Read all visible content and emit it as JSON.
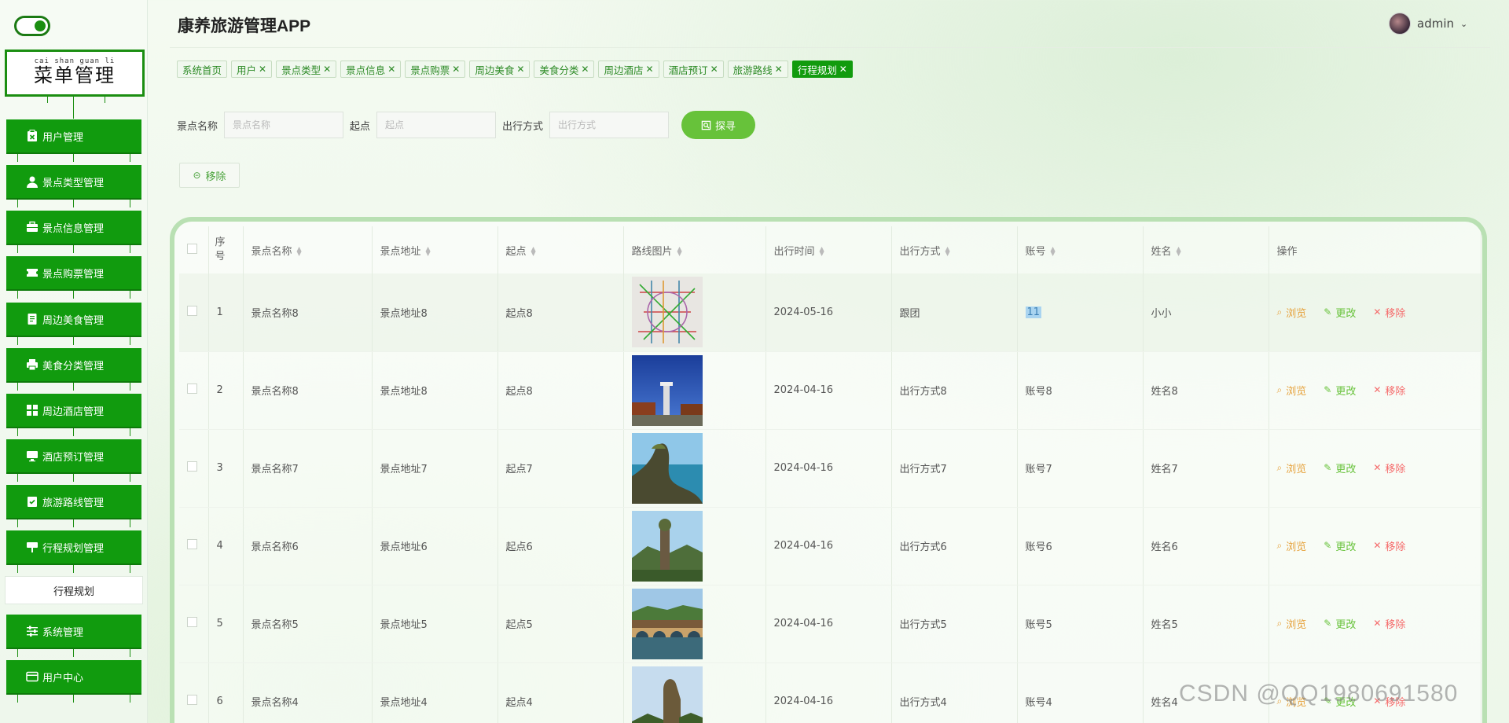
{
  "app": {
    "title": "康养旅游管理APP",
    "user": "admin"
  },
  "sidebar": {
    "title_pinyin": "cai  shan guan  li",
    "title": "菜单管理",
    "items": [
      {
        "label": "用户管理",
        "icon": "clipboard-x-icon"
      },
      {
        "label": "景点类型管理",
        "icon": "user-icon"
      },
      {
        "label": "景点信息管理",
        "icon": "briefcase-icon"
      },
      {
        "label": "景点购票管理",
        "icon": "ticket-icon"
      },
      {
        "label": "周边美食管理",
        "icon": "document-icon"
      },
      {
        "label": "美食分类管理",
        "icon": "printer-icon"
      },
      {
        "label": "周边酒店管理",
        "icon": "grid-icon"
      },
      {
        "label": "酒店预订管理",
        "icon": "monitor-icon"
      },
      {
        "label": "旅游路线管理",
        "icon": "clipboard-check-icon"
      },
      {
        "label": "行程规划管理",
        "icon": "sign-icon"
      },
      {
        "label": "系统管理",
        "icon": "sliders-icon"
      },
      {
        "label": "用户中心",
        "icon": "card-icon"
      }
    ],
    "submenu": "行程规划"
  },
  "tags": [
    {
      "label": "系统首页",
      "closable": false
    },
    {
      "label": "用户",
      "closable": true
    },
    {
      "label": "景点类型",
      "closable": true
    },
    {
      "label": "景点信息",
      "closable": true
    },
    {
      "label": "景点购票",
      "closable": true
    },
    {
      "label": "周边美食",
      "closable": true
    },
    {
      "label": "美食分类",
      "closable": true
    },
    {
      "label": "周边酒店",
      "closable": true
    },
    {
      "label": "酒店预订",
      "closable": true
    },
    {
      "label": "旅游路线",
      "closable": true
    },
    {
      "label": "行程规划",
      "closable": true,
      "active": true
    }
  ],
  "search": {
    "name_label": "景点名称",
    "name_placeholder": "景点名称",
    "start_label": "起点",
    "start_placeholder": "起点",
    "mode_label": "出行方式",
    "mode_placeholder": "出行方式",
    "button": "探寻"
  },
  "remove_button": "移除",
  "table": {
    "headers": [
      "序号",
      "景点名称",
      "景点地址",
      "起点",
      "路线图片",
      "出行时间",
      "出行方式",
      "账号",
      "姓名",
      "操作"
    ],
    "actions": {
      "view": "浏览",
      "edit": "更改",
      "delete": "移除"
    },
    "rows": [
      {
        "no": "1",
        "name": "景点名称8",
        "addr": "景点地址8",
        "start": "起点8",
        "image": "metro-map",
        "time": "2024-05-16",
        "mode": "跟团",
        "account": "11",
        "person": "小小"
      },
      {
        "no": "2",
        "name": "景点名称8",
        "addr": "景点地址8",
        "start": "起点8",
        "image": "blue-sky-monument",
        "time": "2024-04-16",
        "mode": "出行方式8",
        "account": "账号8",
        "person": "姓名8"
      },
      {
        "no": "3",
        "name": "景点名称7",
        "addr": "景点地址7",
        "start": "起点7",
        "image": "coastal-rock",
        "time": "2024-04-16",
        "mode": "出行方式7",
        "account": "账号7",
        "person": "姓名7"
      },
      {
        "no": "4",
        "name": "景点名称6",
        "addr": "景点地址6",
        "start": "起点6",
        "image": "stone-pillar-valley",
        "time": "2024-04-16",
        "mode": "出行方式6",
        "account": "账号6",
        "person": "姓名6"
      },
      {
        "no": "5",
        "name": "景点名称5",
        "addr": "景点地址5",
        "start": "起点5",
        "image": "river-town-bridge",
        "time": "2024-04-16",
        "mode": "出行方式5",
        "account": "账号5",
        "person": "姓名5"
      },
      {
        "no": "6",
        "name": "景点名称4",
        "addr": "景点地址4",
        "start": "起点4",
        "image": "karst-peak",
        "time": "2024-04-16",
        "mode": "出行方式4",
        "account": "账号4",
        "person": "姓名4"
      }
    ]
  },
  "watermark": "CSDN @QQ1980691580",
  "colors": {
    "primary": "#119b0e",
    "accent": "#67c23a",
    "view": "#e6a23c",
    "delete": "#f56c6c"
  }
}
